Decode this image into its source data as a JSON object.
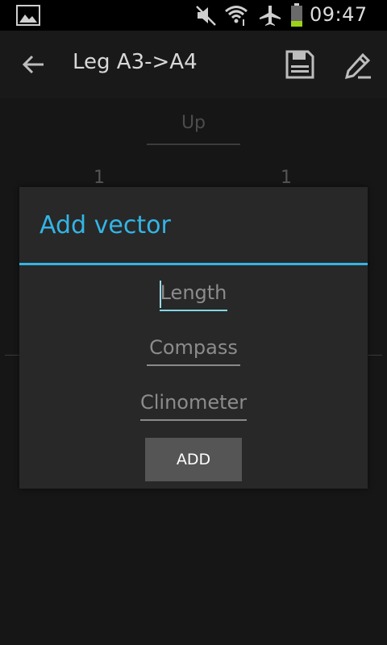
{
  "status_bar": {
    "time": "09:47",
    "icons": [
      "gallery-icon",
      "mute-icon",
      "wifi-icon",
      "airplane-mode-icon",
      "battery-icon"
    ]
  },
  "action_bar": {
    "title": "Leg A3->A4",
    "icons": [
      "back-arrow-icon",
      "save-icon",
      "edit-icon"
    ]
  },
  "background": {
    "up_field_placeholder": "Up",
    "left_number": "1",
    "right_number": "1"
  },
  "dialog": {
    "title": "Add vector",
    "fields": {
      "length_placeholder": "Length",
      "compass_placeholder": "Compass",
      "clinometer_placeholder": "Clinometer"
    },
    "add_button_label": "ADD"
  },
  "colors": {
    "accent": "#33b5e5",
    "dialog_background": "#282828",
    "button_background": "#555555"
  }
}
